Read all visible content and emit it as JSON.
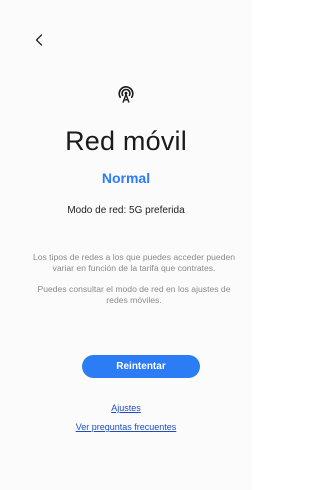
{
  "header": {
    "back_icon": "chevron-left-icon"
  },
  "main": {
    "icon": "mobile-network-antenna-icon",
    "title": "Red móvil",
    "status": "Normal",
    "network_mode": "Modo de red: 5G preferida",
    "description_1": "Los tipos de redes a los que puedes acceder pueden variar en función de la tarifa que contrates.",
    "description_2": "Puedes consultar el modo de red en los ajustes de redes móviles.",
    "retry_label": "Reintentar",
    "settings_link": "Ajustes",
    "faq_link": "Ver preguntas frecuentes"
  },
  "colors": {
    "accent": "#2b7cf5",
    "link": "#1f4fbf",
    "background": "#fbfbfb"
  }
}
